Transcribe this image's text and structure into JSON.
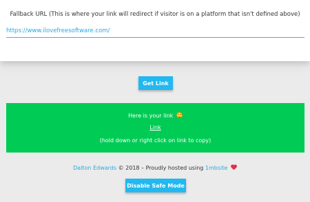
{
  "fallback": {
    "label": "Fallback URL (This is where your link will redirect if visitor is on a platform that isn't defined above)",
    "value": "https://www.ilovefreesoftware.com/",
    "placeholder": ""
  },
  "actions": {
    "get_link_label": "Get Link",
    "safe_mode_label": "Disable Safe Mode"
  },
  "result": {
    "title": "Here is your link",
    "title_icon": "grinning-face-icon",
    "link_label": "Link",
    "hint": "(hold down or right click on link to copy)"
  },
  "footer": {
    "author": "Dalton Edwards",
    "copyright": "© 2018 – Proudly hosted using",
    "host": "1mbsite",
    "host_icon": "heart-gem-icon"
  },
  "colors": {
    "accent": "#22b8f0",
    "success": "#00cc55",
    "link": "#29a8e0",
    "background": "#ebebeb"
  }
}
